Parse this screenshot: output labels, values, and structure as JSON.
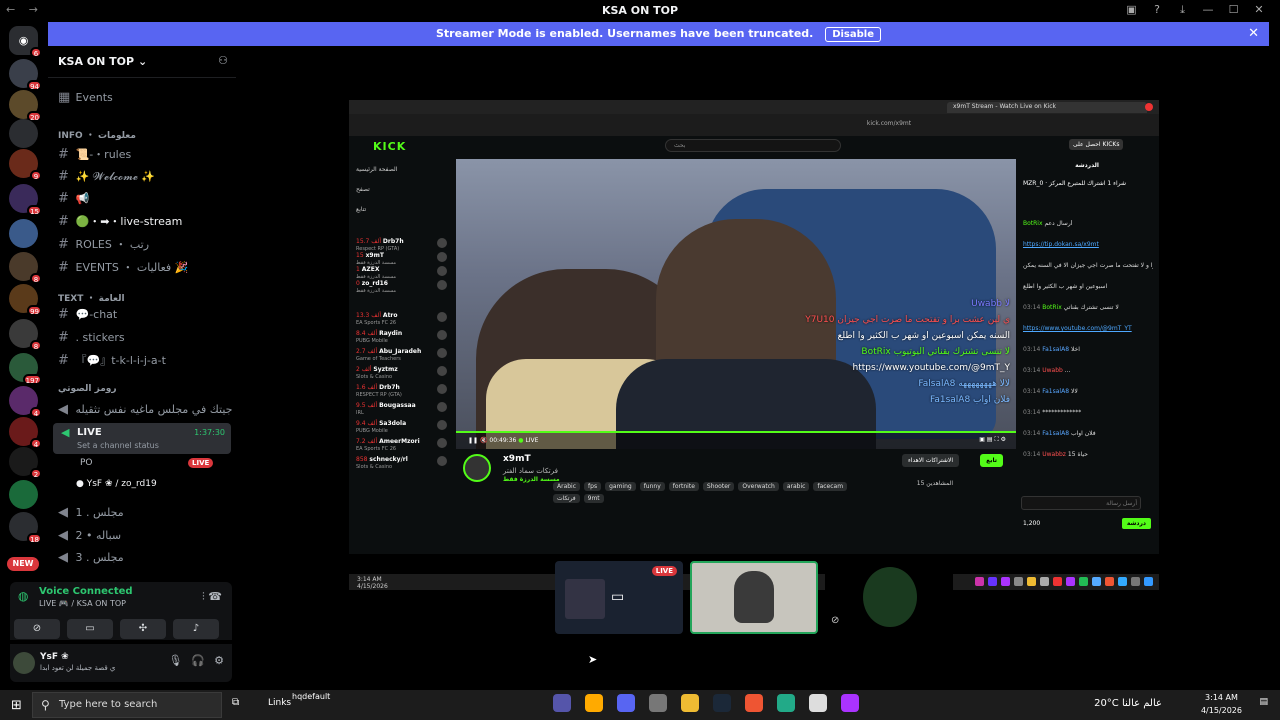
{
  "titlebar": {
    "title": "KSA ON TOP",
    "back": "←",
    "forward": "→"
  },
  "banner": {
    "text": "Streamer Mode is enabled. Usernames have been truncated.",
    "button": "Disable"
  },
  "servers": [
    {
      "badge": "6"
    },
    {
      "badge": "94"
    },
    {
      "badge": "20"
    },
    {
      "badge": ""
    },
    {
      "badge": "9"
    },
    {
      "badge": "15"
    },
    {
      "badge": ""
    },
    {
      "badge": "8"
    },
    {
      "badge": "99"
    },
    {
      "badge": "8"
    },
    {
      "badge": "197"
    },
    {
      "badge": "4"
    },
    {
      "badge": "4"
    },
    {
      "badge": "2"
    },
    {
      "badge": ""
    },
    {
      "badge": "18"
    },
    {
      "badge": "NEW"
    }
  ],
  "guild": {
    "name": "KSA ON TOP",
    "events": "Events",
    "categories": {
      "info": "INFO ・ معلومات",
      "text": "TEXT ・ العامة",
      "voice": "رومز الصوتي"
    },
    "channels": [
      {
        "name": "📜-・rules"
      },
      {
        "name": "✨ 𝓦𝓮𝓵𝓬𝓸𝓶𝓮 ✨"
      },
      {
        "name": "📢"
      },
      {
        "name": "🟢・➡・live-stream"
      },
      {
        "name": "ROLES ・ رتب"
      },
      {
        "name": "EVENTS ・ فعاليات 🎉"
      },
      {
        "name": "💬-chat"
      },
      {
        "name": ". stickers"
      },
      {
        "name": "『💬』t-k-l-i-j-a-t"
      }
    ],
    "voice_channels": {
      "first": "جيتك في مجلس ماغيه نفس تثقيله",
      "live": {
        "name": "LIVE",
        "status": "Set a channel status",
        "time": "1:37:30"
      },
      "users": [
        {
          "name": "PO",
          "live": "LIVE"
        },
        {
          "name": "YsF ❀ / zo_rd19"
        }
      ],
      "others": [
        "مجلس . 1",
        "سباله • 2",
        "مجلس . 3"
      ]
    }
  },
  "voice_connected": {
    "title": "Voice Connected",
    "sub": "LIVE 🎮 / KSA ON TOP"
  },
  "user_panel": {
    "name": "YsF ❀",
    "status": "ي قصة جميلة لن تعود ابدا"
  },
  "kick": {
    "tab": "x9mT Stream - Watch Live on Kick",
    "url": "kick.com/x9mt",
    "logo": "KICK",
    "search": "بحث",
    "kicks": "احصل على KICKs",
    "sidebar": [
      {
        "label": "الصفحة الرئيسية"
      },
      {
        "label": "تصفح"
      },
      {
        "label": "تتابع"
      },
      {
        "label": "تابع"
      }
    ],
    "followed": [
      {
        "name": "Drb7h",
        "count": "15.7 ألف",
        "sub": "Respect RP (GTA)"
      },
      {
        "name": "x9mT",
        "count": "15",
        "sub": "مسسة الدرزة فقط"
      },
      {
        "name": "AZEX",
        "count": "1",
        "sub": "مسسة الدرزة فقط"
      },
      {
        "name": "zo_rd16",
        "count": "0",
        "sub": "مسسة الدرزة فقط"
      }
    ],
    "recommended": [
      {
        "name": "Atro",
        "count": "13.3 ألف",
        "sub": "EA Sports FC 26"
      },
      {
        "name": "Raydin",
        "count": "8.4 ألف",
        "sub": "PUBG Mobile"
      },
      {
        "name": "Abu_Jaradeh",
        "count": "2.7 ألف",
        "sub": "Game of Teachers"
      },
      {
        "name": "Syztmz",
        "count": "2 ألف",
        "sub": "Slots & Casino"
      },
      {
        "name": "Drb7h",
        "count": "1.6 ألف",
        "sub": "RESPECT RP (GTA)"
      },
      {
        "name": "Bougassaa",
        "count": "9.5 ألف",
        "sub": "IRL"
      },
      {
        "name": "Sa3dola",
        "count": "9.4 ألف",
        "sub": "PUBG Mobile"
      },
      {
        "name": "AmeerMzori",
        "count": "7.2 ألف",
        "sub": "EA Sports FC 26"
      },
      {
        "name": "schnecky/rl",
        "count": "858",
        "sub": "Slots & Casino"
      }
    ],
    "overlay": [
      {
        "text": "Uwabb لا",
        "color": "#7a7aff"
      },
      {
        "text": "Y7U10 ي لين عشت برا و تفتحت ما صرت اجي جيزان",
        "color": "#ff5050"
      },
      {
        "text": "السنه يمكن اسبوعين او شهر ب الكثير وا اطلع",
        "color": "#ffffff"
      },
      {
        "text": "BotRix لا تنسى تشترك بقناتي اليوتيوب",
        "color": "#53fc18"
      },
      {
        "text": "https://www.youtube.com/@9mT_Y",
        "color": "#ffffff"
      },
      {
        "text": "FalsalA8 لالا ههههههههه",
        "color": "#7ab8ff"
      },
      {
        "text": "Fa1salA8 فلان اواب",
        "color": "#7ab8ff"
      }
    ],
    "player": {
      "time": "00:49:36",
      "status": "LIVE"
    },
    "streamer": {
      "name": "x9mT",
      "subtitle": "فرتكات سماد الفتر",
      "category": "مسسة الدرزة فقط",
      "tags": [
        "Arabic",
        "fps",
        "gaming",
        "funny",
        "fortnite",
        "Shooter",
        "Overwatch",
        "arabic",
        "facecam"
      ],
      "tags2": [
        "فرتكات",
        "9mt"
      ],
      "viewers": "المشاهدين 15",
      "follow": "تابع",
      "subscribe": "الاشتراكات الاهداء"
    },
    "chat": {
      "header": "الدردشة",
      "pinned_user": "MZR_0",
      "pinned": "شراء 1 اشتراك للمتبرع المركز",
      "lines": [
        {
          "t": "",
          "u": "BotRix",
          "m": "أرسال دعم"
        },
        {
          "t": "",
          "u": "",
          "m": "https://tip.dokan.sa/x9mt"
        },
        {
          "t": "",
          "u": "",
          "m": "يبا برا و لا تفتحت ما صرت اجي جيزان الا في السنه يمكن"
        },
        {
          "t": "",
          "u": "",
          "m": "اسبوعين او شهر ب الكثير وا اطلع"
        },
        {
          "t": "03:14",
          "u": "BotRix",
          "m": "لا تنسى تشترك بقناتي"
        },
        {
          "t": "",
          "u": "",
          "m": "https://www.youtube.com/@9mT_YT"
        },
        {
          "t": "03:14",
          "u": "Fa1salA8",
          "m": "اخلا"
        },
        {
          "t": "03:14",
          "u": "Uwabb",
          "m": "..."
        },
        {
          "t": "03:14",
          "u": "Fa1salA8",
          "m": "لالا"
        },
        {
          "t": "03:14",
          "u": "",
          "m": "*************"
        },
        {
          "t": "03:14",
          "u": "Fa1salA8",
          "m": "فلان اواب"
        },
        {
          "t": "03:14",
          "u": "Uwabbz",
          "m": "حياة 15"
        }
      ],
      "input": "أرسل رسالة",
      "send": "دردشة",
      "count": "1,200"
    },
    "taskbar_date": "3:14 AM",
    "taskbar_sub": "4/15/2026"
  },
  "tiles": {
    "live": "LIVE"
  },
  "taskbar": {
    "search": "Type here to search",
    "links": "Links",
    "hq": "hqdefault",
    "weather": "20°C عالم عالنا",
    "lang": "ع",
    "time": "3:14 AM",
    "date": "4/15/2026"
  }
}
